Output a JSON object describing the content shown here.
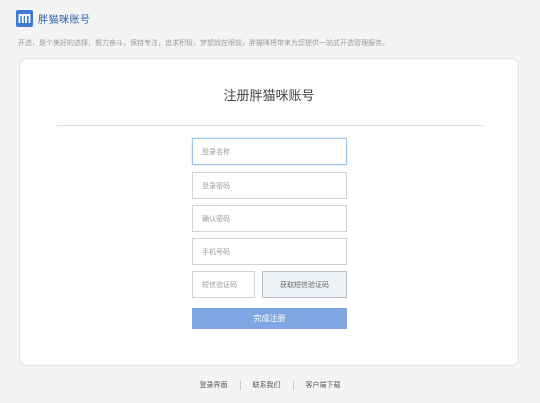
{
  "header": {
    "logo_letter": "m",
    "logo_text": "胖猫咪账号",
    "tagline": "开选，是个美好的选择，努力奋斗，保持专注，追求积极，梦想就在眼前，胖猫咪将带来为您提供一站式开选管理服务。"
  },
  "form": {
    "title": "注册胖猫咪账号",
    "fields": {
      "username": "登录名称",
      "password": "登录密码",
      "confirm": "确认密码",
      "phone": "手机号码",
      "code": "短信验证码"
    },
    "send_code_label": "获取短信验证码",
    "submit_label": "完成注册"
  },
  "footer": {
    "links": [
      "登录界面",
      "联系我们",
      "客户端下载"
    ]
  },
  "colors": {
    "brand": "#3d7ad3",
    "submit": "#7fa6e3",
    "focus_border": "#9cc3ea"
  }
}
